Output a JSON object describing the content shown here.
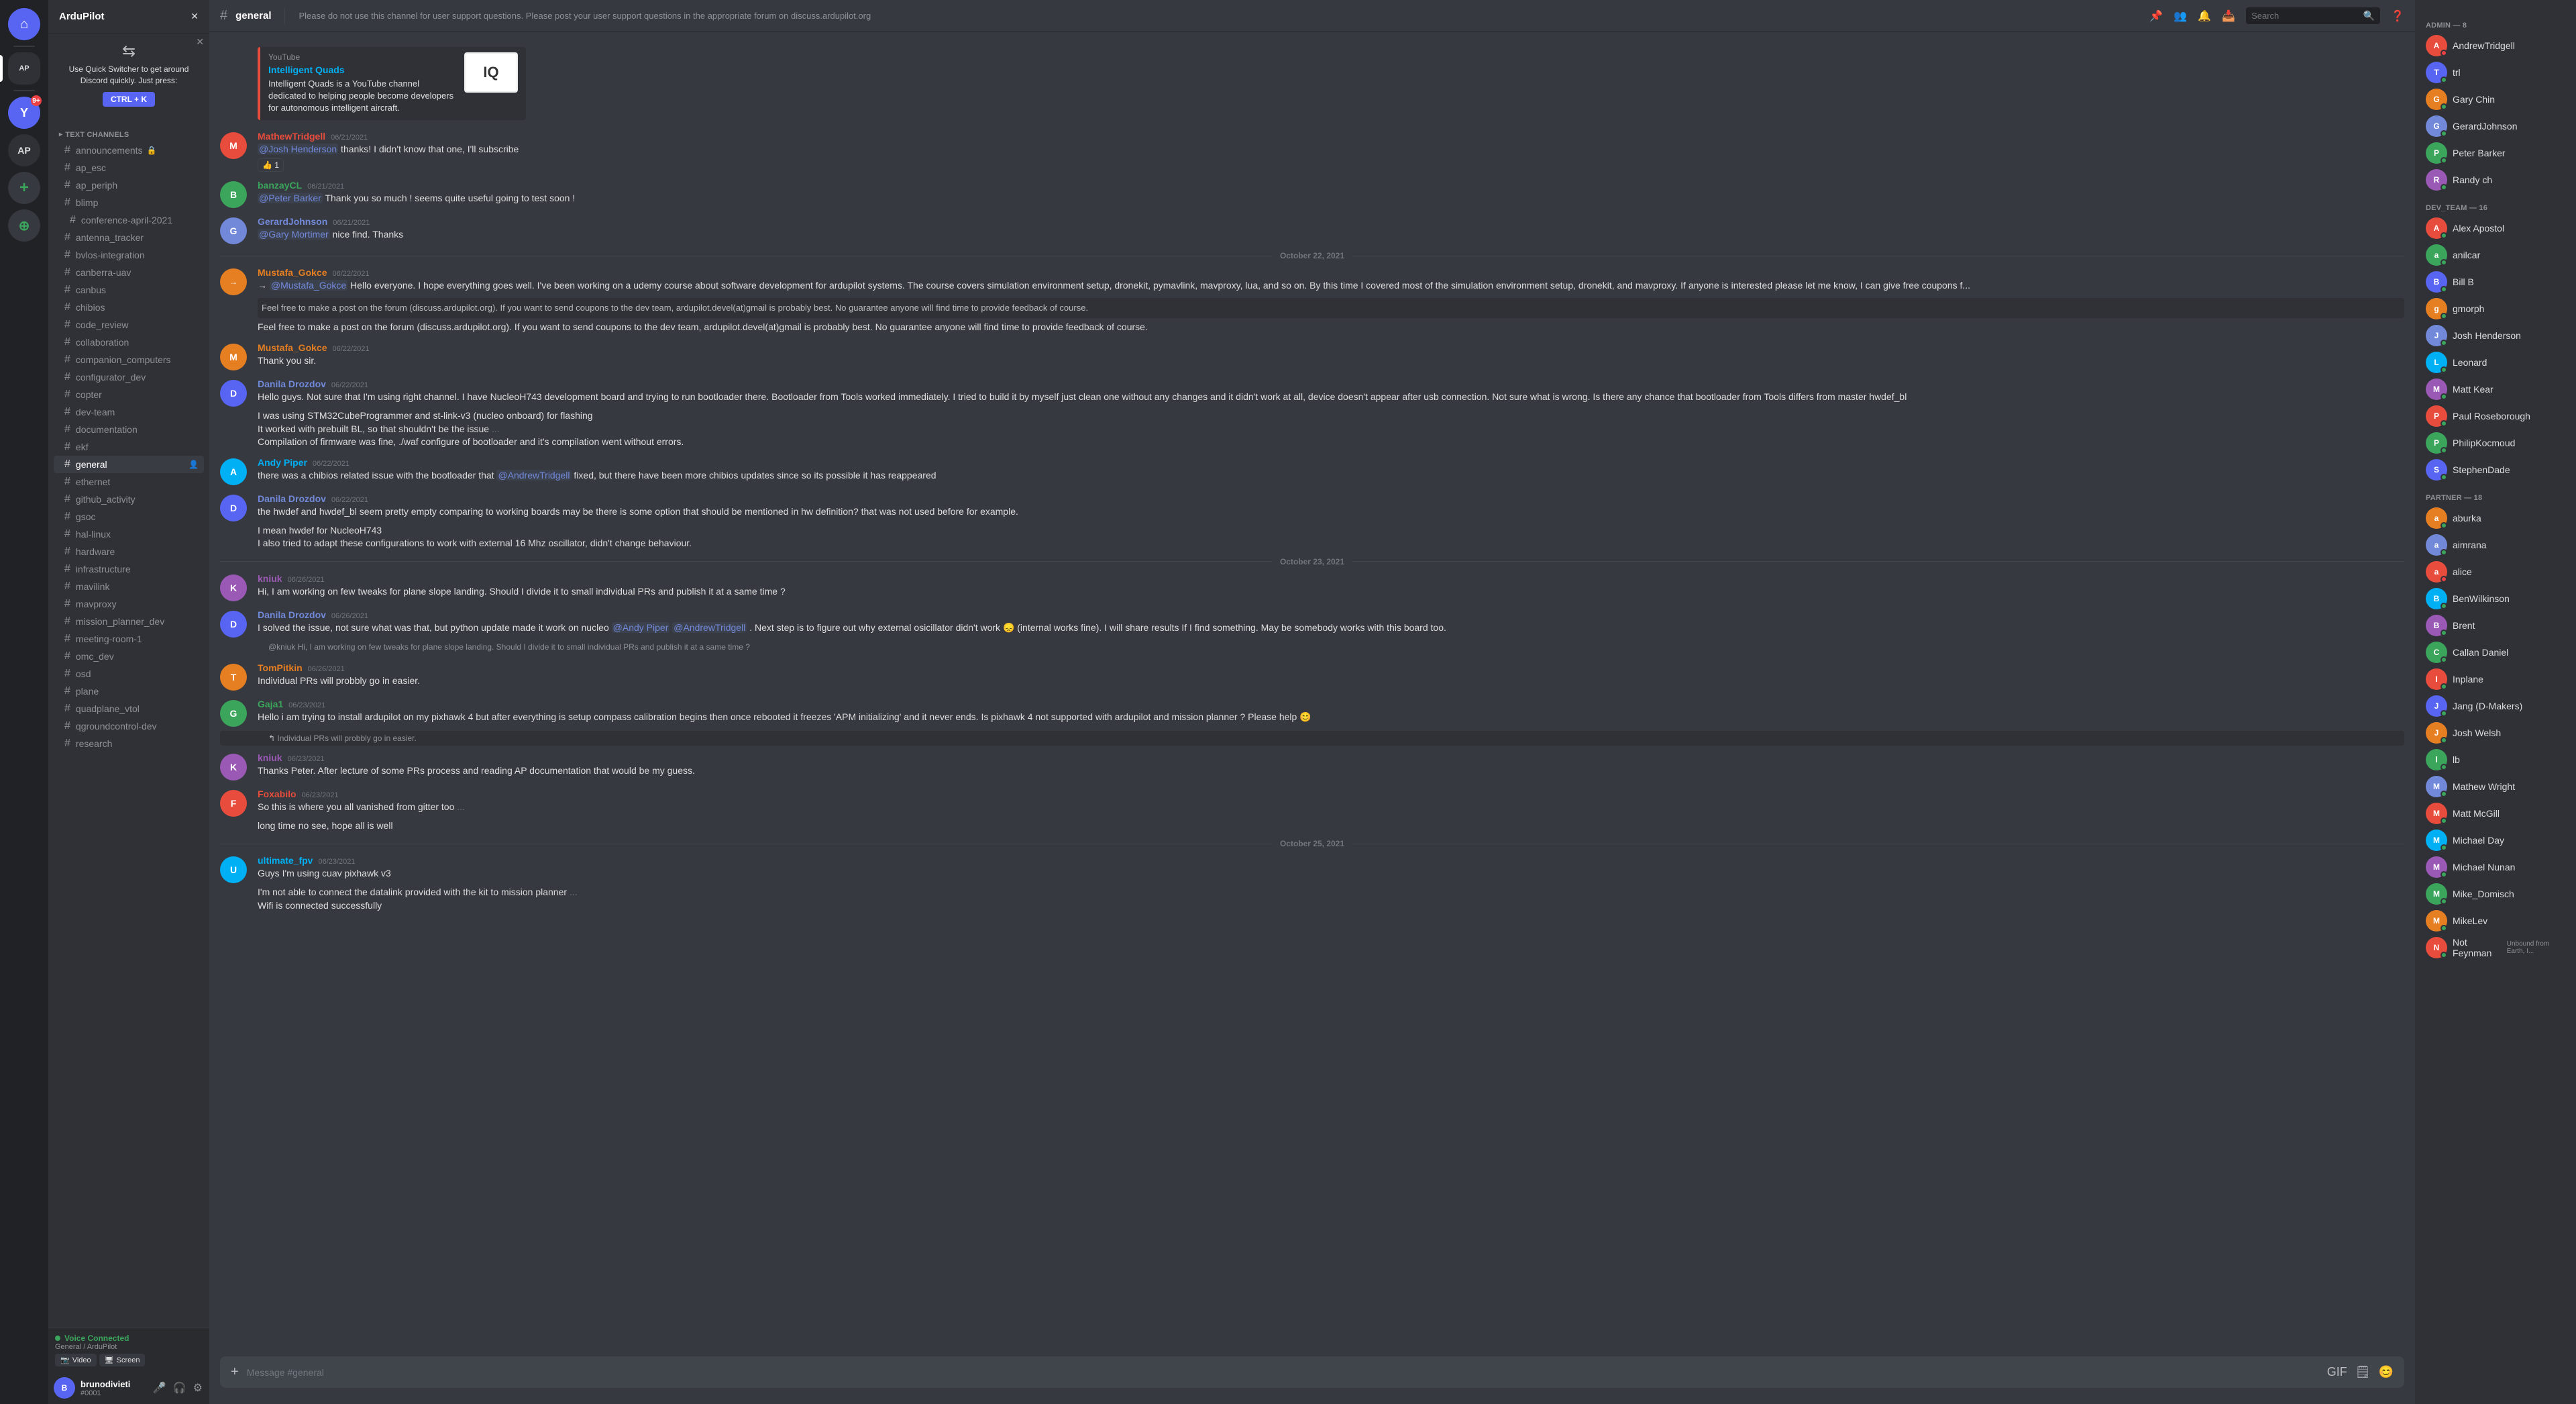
{
  "app": {
    "title": "Discord"
  },
  "server": {
    "name": "ArduPilot",
    "icon_letters": "AP"
  },
  "quick_switcher": {
    "title": "Use Quick Switcher to get around Discord quickly. Just press:",
    "shortcut": "CTRL + K",
    "icon": "⇆"
  },
  "channel_sidebar": {
    "server_name": "ArduPilot",
    "categories": [
      {
        "name": "TEXT CHANNELS",
        "channels": [
          {
            "name": "announcements",
            "type": "hash",
            "locked": true
          },
          {
            "name": "ap_esc",
            "type": "hash"
          },
          {
            "name": "ap_periph",
            "type": "hash"
          },
          {
            "name": "blimp",
            "type": "hash",
            "sub": true
          },
          {
            "name": "conference-april-2021",
            "type": "hash",
            "sub": true
          },
          {
            "name": "antenna_tracker",
            "type": "hash"
          },
          {
            "name": "bvlos-integration",
            "type": "hash"
          },
          {
            "name": "canberra-uav",
            "type": "hash"
          },
          {
            "name": "canbus",
            "type": "hash"
          },
          {
            "name": "chibios",
            "type": "hash"
          },
          {
            "name": "code_review",
            "type": "hash"
          },
          {
            "name": "collaboration",
            "type": "hash"
          },
          {
            "name": "companion_computers",
            "type": "hash"
          },
          {
            "name": "configurator_dev",
            "type": "hash"
          },
          {
            "name": "copter",
            "type": "hash"
          },
          {
            "name": "dev-team",
            "type": "hash"
          },
          {
            "name": "documentation",
            "type": "hash"
          },
          {
            "name": "ekf",
            "type": "hash"
          },
          {
            "name": "general",
            "type": "hash",
            "active": true,
            "notification": true
          },
          {
            "name": "ethernet",
            "type": "hash"
          },
          {
            "name": "github_activity",
            "type": "hash"
          },
          {
            "name": "gsoc",
            "type": "hash"
          },
          {
            "name": "hal-linux",
            "type": "hash"
          },
          {
            "name": "hardware",
            "type": "hash"
          },
          {
            "name": "infrastructure",
            "type": "hash"
          },
          {
            "name": "mavilink",
            "type": "hash"
          },
          {
            "name": "mavproxy",
            "type": "hash"
          },
          {
            "name": "mission_planner_dev",
            "type": "hash"
          },
          {
            "name": "meeting-room-1",
            "type": "hash"
          },
          {
            "name": "omc_dev",
            "type": "hash"
          },
          {
            "name": "osd",
            "type": "hash"
          },
          {
            "name": "plane",
            "type": "hash"
          },
          {
            "name": "quadplane_vtol",
            "type": "hash"
          },
          {
            "name": "qgroundcontrol-dev",
            "type": "hash"
          },
          {
            "name": "research",
            "type": "hash"
          }
        ]
      }
    ],
    "voice_connected": {
      "status": "Voice Connected",
      "channel": "General / ArduPilot",
      "actions": [
        "Video",
        "Screen"
      ]
    }
  },
  "chat": {
    "channel_name": "general",
    "topic": "Please do not use this channel for user support questions. Please post your user support questions in the appropriate forum on discuss.ardupilot.org",
    "input_placeholder": "Message #general",
    "header_icons": [
      "📌",
      "👥",
      "🔔",
      "🔍",
      "❓"
    ],
    "messages": [
      {
        "id": "embed_msg",
        "type": "embed",
        "site": "YouTube",
        "title": "Intelligent Quads",
        "desc": "Intelligent Quads is a YouTube channel dedicated to helping people become developers for autonomous intelligent aircraft.",
        "thumb_text": "IQ"
      },
      {
        "id": "msg1",
        "user": "MathewTridgell",
        "timestamp": "06/21/2021",
        "avatar_color": "#e74c3c",
        "avatar_letter": "M",
        "text": "@Josh Henderson  thanks! I didn't know that one, I'll subscribe",
        "reaction": "👍 1"
      },
      {
        "id": "msg2",
        "user": "banzayCL",
        "timestamp": "06/21/2021",
        "avatar_color": "#3ba55c",
        "avatar_letter": "B",
        "text": "@Peter Barker  Thank you so much ! seems quite useful going to test soon !"
      },
      {
        "id": "msg3",
        "user": "GerardJohnson",
        "timestamp": "06/21/2021",
        "avatar_color": "#7289da",
        "avatar_letter": "G",
        "text": "@Gary Mortimer  nice find. Thanks"
      },
      {
        "id": "date1",
        "type": "date",
        "label": "October 22, 2021"
      },
      {
        "id": "msg4",
        "user": "Mustafa_Gokce",
        "timestamp": "06/22/2021",
        "avatar_color": "#e67e22",
        "avatar_letter": "M",
        "bot": true,
        "text": "→ @Mustafa_Gokce Hello everyone. I hope everything goes well. I've been working on a udemy course about software development for ardupilot systems. The course covers simulation environment setup, dronekit, pymavlink, mavproxy, lua, and so on. By this time I covered most of the simulation environment setup, dronekit, and mavproxy. If anyone is interested please let me know, I can give free coupons f...",
        "continuation": "Feel free to make a post on the forum (discuss.ardupilot.org). If you want to send coupons to the dev team, ardupilot.devel(at)gmail is probably best. No guarantee anyone will find time to provide feedback of course.",
        "continuation2": "Feel free to make a post on the forum (discuss.ardupilot.org). If you want to send coupons to the dev team, ardupilot.devel(at)gmail is probably best. No guarantee anyone will find time to provide feedback of course."
      },
      {
        "id": "msg5",
        "user": "Mustafa_Gokce",
        "timestamp": "06/22/2021",
        "avatar_color": "#e67e22",
        "avatar_letter": "M",
        "text": "Thank you sir."
      },
      {
        "id": "msg6",
        "user": "Danila Drozdov",
        "timestamp": "06/22/2021",
        "avatar_color": "#5865f2",
        "avatar_letter": "D",
        "text": "Hello guys. Not sure that I'm using right channel. I have NucleoH743 development board and trying to run bootloader there. Bootloader from Tools worked immediately. I tried to build it by myself just clean one without any changes and it didn't work at all, device doesn't appear after usb connection. Not sure what is wrong. Is there any chance that bootloader from Tools differs from master hwdef_bl",
        "continuation": "I was using STM32CubeProgrammer and st-link-v3 (nucleo onboard) for flashing",
        "continuation2": "It worked with prebuilt BL, so that shouldn't be the issue ...",
        "continuation3": "Compilation of firmware was fine, ./waf configure of bootloader and it's compilation went without errors."
      },
      {
        "id": "msg7",
        "user": "Andy Piper",
        "timestamp": "06/22/2021",
        "avatar_color": "#00b0f4",
        "avatar_letter": "A",
        "text": "there was a chibios related issue with the bootloader that @AndrewTridgell  fixed, but there have been more chibios updates since so its possible it has reappeared"
      },
      {
        "id": "msg8",
        "user": "Danila Drozdov",
        "timestamp": "06/22/2021",
        "avatar_color": "#5865f2",
        "avatar_letter": "D",
        "text": "the hwdef and hwdef_bl seem pretty empty comparing to working boards may be there is some option that should be mentioned in hw definition? that was not used before for example.",
        "continuation": "I mean hwdef for NucleoH743",
        "continuation2": "I also tried to adapt these configurations to work with external 16 Mhz oscillator, didn't change behaviour."
      },
      {
        "id": "date2",
        "type": "date",
        "label": "October 23, 2021"
      },
      {
        "id": "msg9",
        "user": "kniuk",
        "timestamp": "06/26/2021",
        "avatar_color": "#9b59b6",
        "avatar_letter": "K",
        "text": "Hi, I am working on  few tweaks for plane slope landing. Should I divide it to small individual PRs  and publish it at a same time ?"
      },
      {
        "id": "msg10",
        "user": "Danila Drozdov",
        "timestamp": "06/26/2021",
        "avatar_color": "#5865f2",
        "avatar_letter": "D",
        "text": "I solved the issue, not sure what was that, but python update made it work on nucleo @Andy Piper  @AndrewTridgell . Next step is to figure out why external osicillator didn't work 😞 (internal works fine). I will share results If I find something. May be somebody works with this board too.",
        "continuation": "@kniuk  Hi, I am working on  few tweaks for plane slope landing. Should I divide it to small individual PRs  and publish it at a same time ?"
      },
      {
        "id": "msg11",
        "user": "TomPitkin",
        "timestamp": "06/26/2021",
        "avatar_color": "#e67e22",
        "avatar_letter": "T",
        "text": "Individual PRs will probbly go in easier."
      },
      {
        "id": "msg12",
        "user": "Gaja1",
        "timestamp": "06/23/2021",
        "avatar_color": "#3ba55c",
        "avatar_letter": "G",
        "text": "Hello i am trying to install ardupilot on my pixhawk 4 but after everything is setup compass calibration begins then once rebooted it freezes 'APM initializing' and it never ends. Is pixhawk 4 not supported with ardupilot and mission planner ? Please help 😊"
      },
      {
        "id": "msg13_ref",
        "type": "reference",
        "ref_user": "TomPitkin",
        "ref_text": "Individual PRs will probbly go in easier."
      },
      {
        "id": "msg13",
        "user": "kniuk",
        "timestamp": "06/23/2021",
        "avatar_color": "#9b59b6",
        "avatar_letter": "K",
        "text": "Thanks Peter. After lecture of some PRs process and reading AP documentation that would be my guess."
      },
      {
        "id": "msg14",
        "user": "Foxabilo",
        "timestamp": "06/23/2021",
        "avatar_color": "#e74c3c",
        "avatar_letter": "F",
        "text": "So this is where you all vanished from gitter too ...",
        "continuation": "long time no see, hope all is well"
      },
      {
        "id": "date3",
        "type": "date",
        "label": "October 25, 2021"
      },
      {
        "id": "msg15",
        "user": "ultimate_fpv",
        "timestamp": "06/23/2021",
        "avatar_color": "#00b0f4",
        "avatar_letter": "U",
        "text": "Guys I'm using cuav pixhawk v3",
        "continuation": "I'm not able to connect the  datalink provided with the kit to mission planner ...",
        "continuation2": "Wifi is connected successfully"
      }
    ]
  },
  "members_sidebar": {
    "categories": [
      {
        "name": "ADMIN — 8",
        "members": [
          {
            "name": "AndrewTridgell",
            "status": "online",
            "color": "#e74c3c",
            "letter": "A",
            "dot_color": "#ed4245"
          },
          {
            "name": "trl",
            "status": "online",
            "color": "#5865f2",
            "letter": "T",
            "dot_color": "#3ba55c"
          },
          {
            "name": "Gary Chin",
            "status": "dnd",
            "color": "#e67e22",
            "letter": "G",
            "dot_color": "#ed4245"
          },
          {
            "name": "GerardJohnson",
            "status": "online",
            "color": "#7289da",
            "letter": "G",
            "dot_color": "#3ba55c"
          },
          {
            "name": "Peter Barker",
            "status": "online",
            "color": "#3ba55c",
            "letter": "P",
            "dot_color": "#3ba55c"
          },
          {
            "name": "Randy ch",
            "status": "online",
            "color": "#9b59b6",
            "letter": "R",
            "dot_color": "#3ba55c"
          }
        ]
      },
      {
        "name": "DEV_TEAM — 16",
        "members": [
          {
            "name": "Alex Apostol",
            "status": "online",
            "color": "#e74c3c",
            "letter": "A",
            "dot_color": "#3ba55c"
          },
          {
            "name": "anilcar",
            "status": "online",
            "color": "#3ba55c",
            "letter": "a",
            "dot_color": "#3ba55c"
          },
          {
            "name": "Bill B",
            "status": "online",
            "color": "#5865f2",
            "letter": "B",
            "dot_color": "#3ba55c"
          },
          {
            "name": "gmorph",
            "status": "online",
            "color": "#e67e22",
            "letter": "g",
            "dot_color": "#3ba55c"
          },
          {
            "name": "Josh Henderson",
            "status": "online",
            "color": "#7289da",
            "letter": "J",
            "dot_color": "#3ba55c"
          },
          {
            "name": "Leonard",
            "status": "online",
            "color": "#00b0f4",
            "letter": "L",
            "dot_color": "#3ba55c"
          },
          {
            "name": "Matt Kear",
            "status": "online",
            "color": "#9b59b6",
            "letter": "M",
            "dot_color": "#3ba55c"
          },
          {
            "name": "Paul Roseborough",
            "status": "online",
            "color": "#e74c3c",
            "letter": "P",
            "dot_color": "#3ba55c"
          },
          {
            "name": "PhilipKocmoud",
            "status": "online",
            "color": "#3ba55c",
            "letter": "P",
            "dot_color": "#3ba55c"
          },
          {
            "name": "StephenDade",
            "status": "online",
            "color": "#5865f2",
            "letter": "S",
            "dot_color": "#3ba55c"
          }
        ]
      },
      {
        "name": "PARTNER — 18",
        "members": [
          {
            "name": "aburka",
            "status": "online",
            "color": "#e67e22",
            "letter": "a",
            "dot_color": "#3ba55c"
          },
          {
            "name": "aimrana",
            "status": "online",
            "color": "#7289da",
            "letter": "a",
            "dot_color": "#3ba55c"
          },
          {
            "name": "alice",
            "status": "dnd",
            "color": "#e74c3c",
            "letter": "a",
            "dot_color": "#ed4245"
          },
          {
            "name": "BenWilkinson",
            "status": "online",
            "color": "#00b0f4",
            "letter": "B",
            "dot_color": "#3ba55c"
          },
          {
            "name": "Brent",
            "status": "online",
            "color": "#9b59b6",
            "letter": "B",
            "dot_color": "#3ba55c"
          },
          {
            "name": "Callan Daniel",
            "status": "online",
            "color": "#3ba55c",
            "letter": "C",
            "dot_color": "#3ba55c"
          },
          {
            "name": "Inplane",
            "status": "online",
            "color": "#e74c3c",
            "letter": "I",
            "dot_color": "#3ba55c"
          },
          {
            "name": "Jang (D-Makers)",
            "status": "online",
            "color": "#5865f2",
            "letter": "J",
            "dot_color": "#3ba55c"
          },
          {
            "name": "Josh Welsh",
            "status": "online",
            "color": "#e67e22",
            "letter": "J",
            "dot_color": "#3ba55c"
          },
          {
            "name": "lb",
            "status": "online",
            "color": "#3ba55c",
            "letter": "l",
            "dot_color": "#3ba55c"
          },
          {
            "name": "Mathew Wright",
            "status": "online",
            "color": "#7289da",
            "letter": "M",
            "dot_color": "#3ba55c"
          },
          {
            "name": "Matt McGill",
            "status": "online",
            "color": "#e74c3c",
            "letter": "M",
            "dot_color": "#3ba55c"
          },
          {
            "name": "Michael Day",
            "status": "online",
            "color": "#00b0f4",
            "letter": "M",
            "dot_color": "#3ba55c"
          },
          {
            "name": "Michael Nunan",
            "status": "online",
            "color": "#9b59b6",
            "letter": "M",
            "dot_color": "#3ba55c"
          },
          {
            "name": "Mike_Domisch",
            "status": "online",
            "color": "#3ba55c",
            "letter": "M",
            "dot_color": "#3ba55c"
          },
          {
            "name": "MikeLev",
            "status": "online",
            "color": "#e67e22",
            "letter": "M",
            "dot_color": "#3ba55c"
          },
          {
            "name": "Not Feynman",
            "status": "online",
            "color": "#e74c3c",
            "letter": "N",
            "dot_color": "#3ba55c"
          }
        ]
      }
    ]
  },
  "user": {
    "name": "brunodivieti",
    "tag": "#0001",
    "avatar_letter": "B",
    "avatar_color": "#5865f2"
  },
  "search": {
    "placeholder": "Search"
  }
}
